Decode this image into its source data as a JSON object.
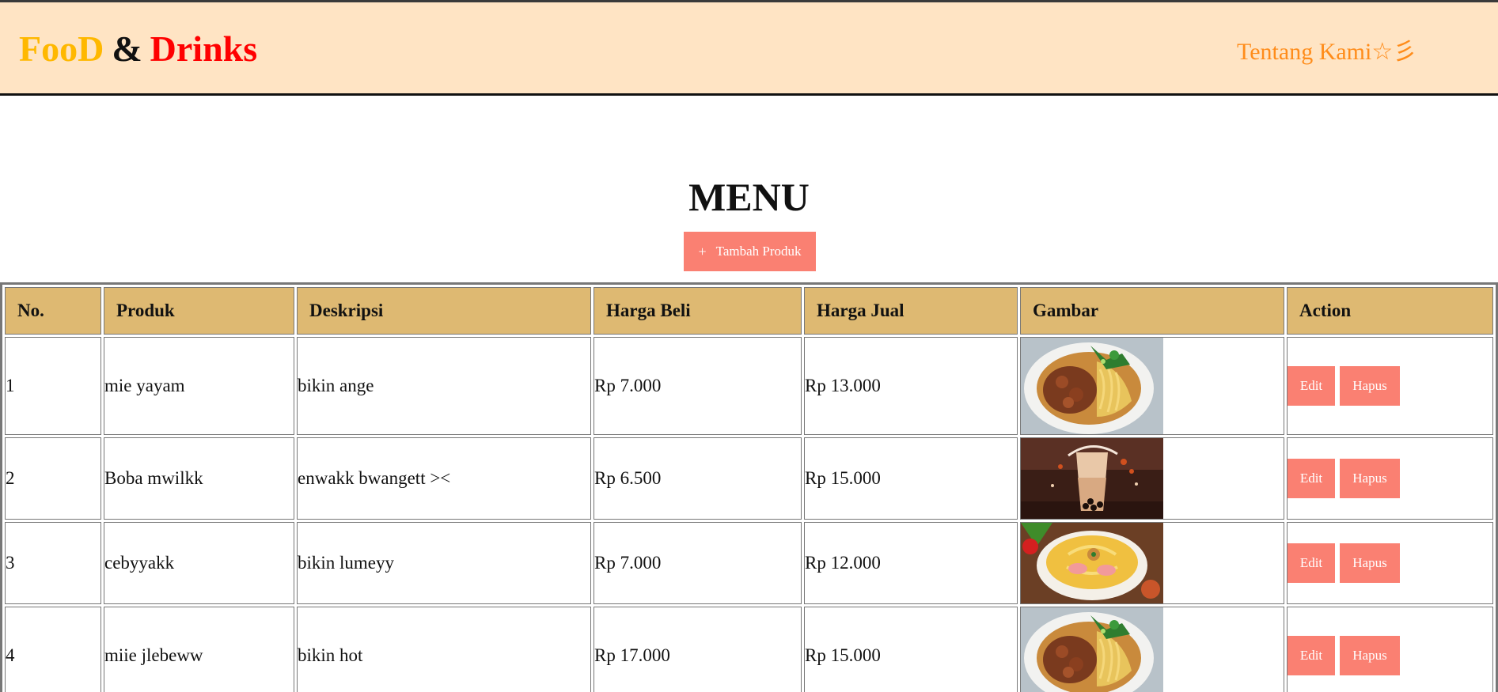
{
  "header": {
    "brand_part1": "FooD",
    "brand_amp": "&",
    "brand_part2": "Drinks",
    "nav_link": "Tentang Kami☆彡"
  },
  "main": {
    "title": "MENU",
    "add_button": {
      "icon": "+",
      "label": "Tambah Produk"
    }
  },
  "table": {
    "columns": [
      "No.",
      "Produk",
      "Deskripsi",
      "Harga Beli",
      "Harga Jual",
      "Gambar",
      "Action"
    ],
    "edit_label": "Edit",
    "delete_label": "Hapus",
    "rows": [
      {
        "no": "1",
        "produk": "mie yayam",
        "deskripsi": "bikin ange",
        "harga_beli": "Rp 7.000",
        "harga_jual": "Rp 13.000",
        "image": "noodle-chicken-image"
      },
      {
        "no": "2",
        "produk": "Boba mwilkk",
        "deskripsi": "enwakk bwangett ><",
        "harga_beli": "Rp 6.500",
        "harga_jual": "Rp 15.000",
        "image": "boba-milk-image"
      },
      {
        "no": "3",
        "produk": "cebyyakk",
        "deskripsi": "bikin lumeyy",
        "harga_beli": "Rp 7.000",
        "harga_jual": "Rp 12.000",
        "image": "seblak-bowl-image"
      },
      {
        "no": "4",
        "produk": "miie jlebeww",
        "deskripsi": "bikin hot",
        "harga_beli": "Rp 17.000",
        "harga_jual": "Rp 15.000",
        "image": "noodle-chicken-image"
      }
    ]
  },
  "colors": {
    "header_bg": "#ffe4c4",
    "brand_yellow": "#ffb800",
    "brand_red": "#ff0000",
    "nav_orange": "#ff8c1a",
    "button_salmon": "#fa8072",
    "table_header_bg": "#deb972"
  }
}
